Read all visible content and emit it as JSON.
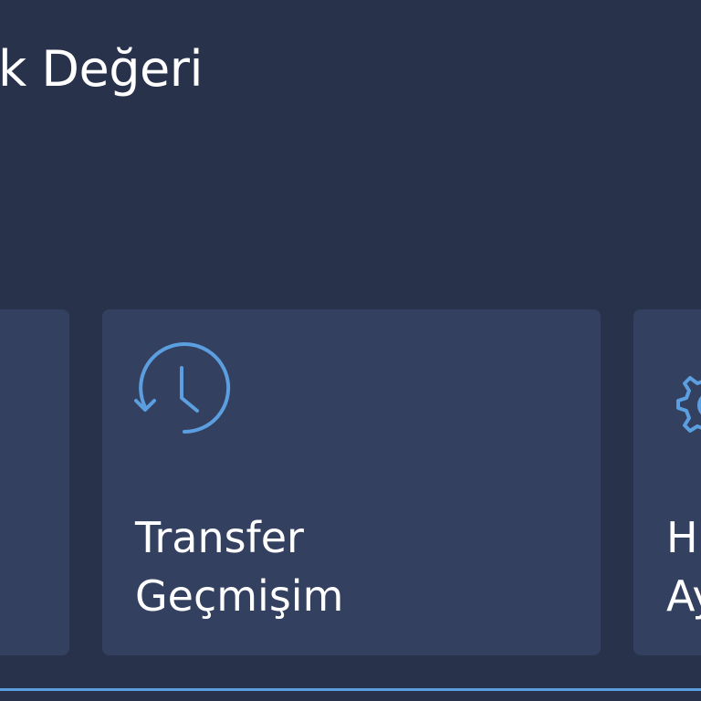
{
  "header": {
    "title": "k Değeri"
  },
  "cards": [
    {
      "label_line1": "",
      "label_line2": "",
      "icon": ""
    },
    {
      "label_line1": "Transfer",
      "label_line2": "Geçmişim",
      "icon": "history-icon"
    },
    {
      "label_line1": "H",
      "label_line2": "Ay",
      "icon": "gear-icon"
    }
  ],
  "colors": {
    "background": "#28324b",
    "card": "#344060",
    "accent": "#5b9fe0",
    "text": "#ffffff"
  }
}
